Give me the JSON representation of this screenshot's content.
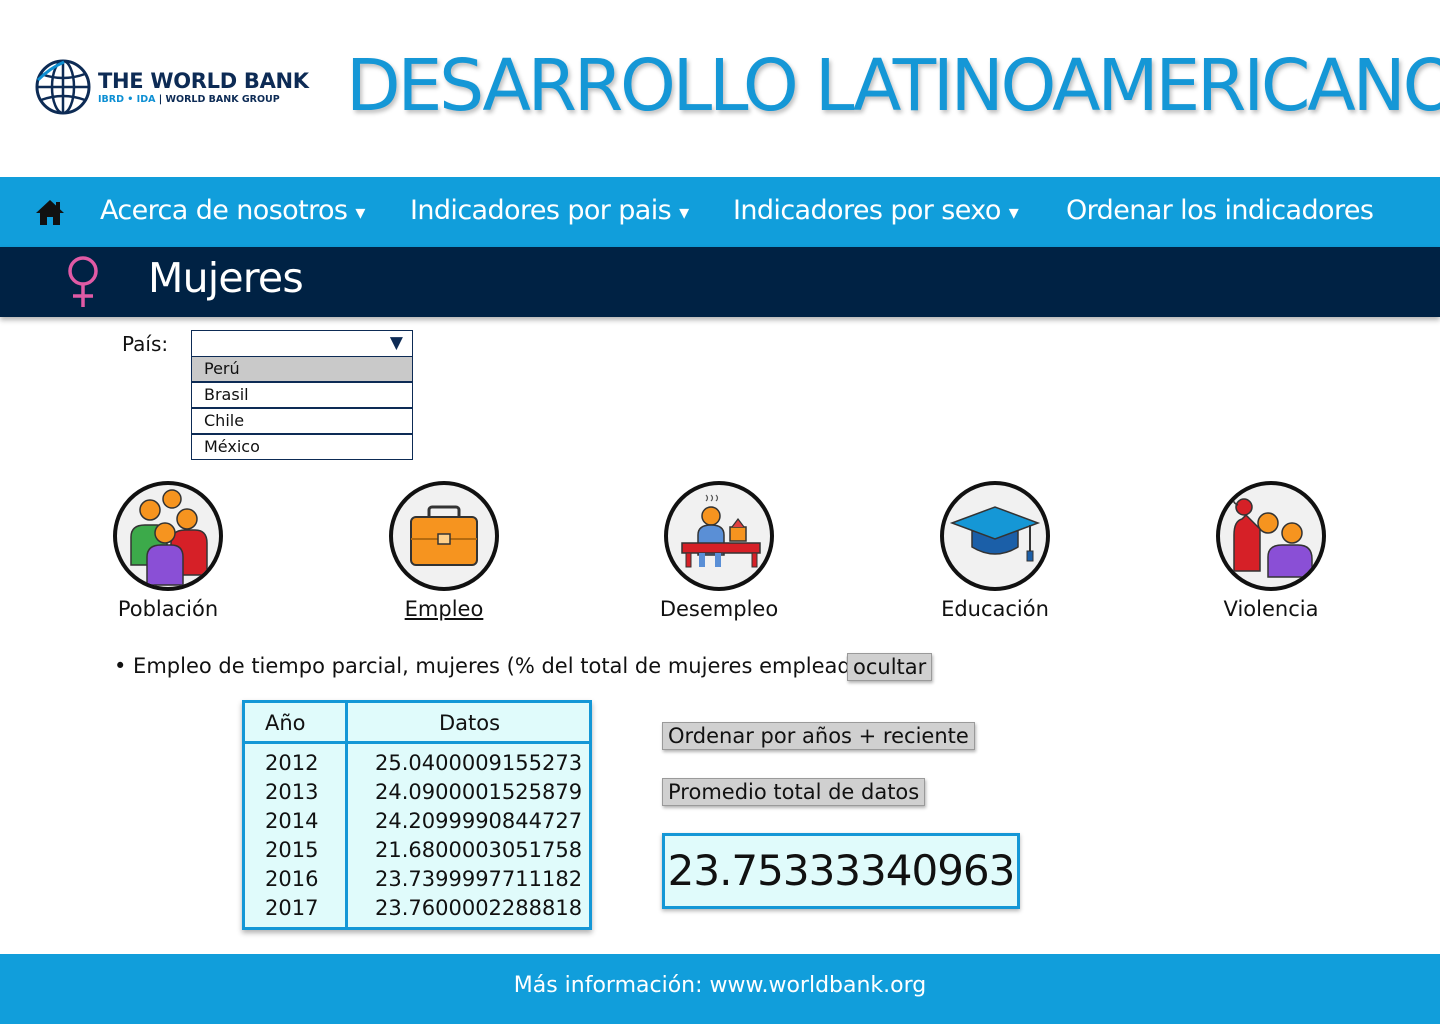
{
  "brand": {
    "name": "THE WORLD BANK",
    "sub_ibrd": "IBRD • IDA",
    "sub_sep": " | ",
    "sub_group": "WORLD BANK GROUP"
  },
  "page_title": "DESARROLLO LATINOAMERICANO",
  "nav": {
    "home_icon": "home-icon",
    "items": [
      {
        "label": "Acerca de nosotros",
        "caret": "▾"
      },
      {
        "label": "Indicadores por pais",
        "caret": "▾"
      },
      {
        "label": "Indicadores por sexo",
        "caret": "▾"
      },
      {
        "label": "Ordenar los indicadores",
        "caret": ""
      }
    ]
  },
  "section": {
    "icon": "female-symbol-icon",
    "title": "Mujeres"
  },
  "country_select": {
    "label": "País:",
    "value": "",
    "arrow": "▼",
    "options": [
      "Perú",
      "Brasil",
      "Chile",
      "México"
    ],
    "highlighted": "Perú"
  },
  "categories": [
    {
      "label": "Población",
      "icon": "population-icon"
    },
    {
      "label": "Empleo",
      "icon": "briefcase-icon",
      "active": true
    },
    {
      "label": "Desempleo",
      "icon": "unemployed-person-icon"
    },
    {
      "label": "Educación",
      "icon": "graduation-cap-icon"
    },
    {
      "label": "Violencia",
      "icon": "violence-icon"
    }
  ],
  "indicator": {
    "text": "• Empleo de tiempo parcial, mujeres (% del total de mujeres empleadas)",
    "hide_button": "ocultar"
  },
  "table": {
    "headers": [
      "Año",
      "Datos"
    ],
    "years": [
      "2012",
      "2013",
      "2014",
      "2015",
      "2016",
      "2017"
    ],
    "values": [
      "25.0400009155273",
      "24.0900001525879",
      "24.2099990844727",
      "21.6800003051758",
      "23.7399997711182",
      "23.7600002288818"
    ]
  },
  "actions": {
    "sort_button": "Ordenar por años + reciente",
    "average_button": "Promedio total de datos"
  },
  "result": "23.75333340963",
  "footer": "Más información: www.worldbank.org",
  "colors": {
    "accent_blue": "#119edb",
    "navy": "#002244",
    "pink": "#e05aa5"
  }
}
